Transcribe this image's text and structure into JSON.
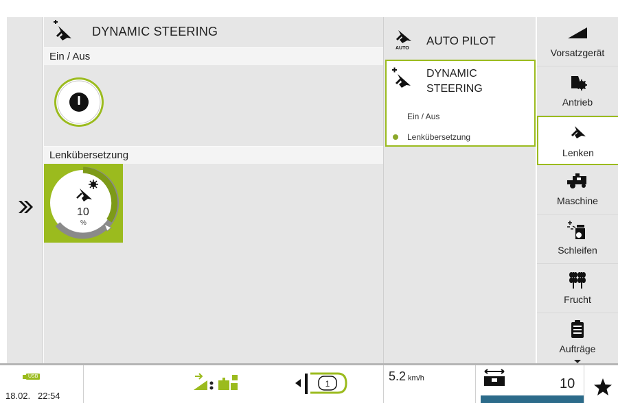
{
  "colors": {
    "accent_green": "#9bbb1e",
    "panel_gray": "#e6e6e6",
    "blue_status": "#2c6b8a"
  },
  "main": {
    "title": "DYNAMIC STEERING",
    "section1_label": "Ein / Aus",
    "section2_label": "Lenkübersetzung",
    "knob2_value": "10",
    "knob2_unit": "%"
  },
  "autopilot": {
    "title": "AUTO PILOT",
    "icon_caption": "AUTO",
    "card": {
      "title_line1": "DYNAMIC",
      "title_line2": "STEERING",
      "item1": "Ein / Aus",
      "item2": "Lenkübersetzung"
    }
  },
  "tabs": [
    {
      "label": "Vorsatzgerät",
      "icon": "header-icon"
    },
    {
      "label": "Antrieb",
      "icon": "drive-icon"
    },
    {
      "label": "Lenken",
      "icon": "steering-icon"
    },
    {
      "label": "Maschine",
      "icon": "machine-icon"
    },
    {
      "label": "Schleifen",
      "icon": "grinding-icon"
    },
    {
      "label": "Frucht",
      "icon": "crop-icon"
    },
    {
      "label": "Aufträge",
      "icon": "clipboard-icon"
    }
  ],
  "active_tab": "Lenken",
  "status": {
    "usb_label": "USB",
    "date": "18.02.",
    "time": "22:54",
    "speed_value": "5.2",
    "speed_unit": "km/h",
    "count": "10"
  }
}
